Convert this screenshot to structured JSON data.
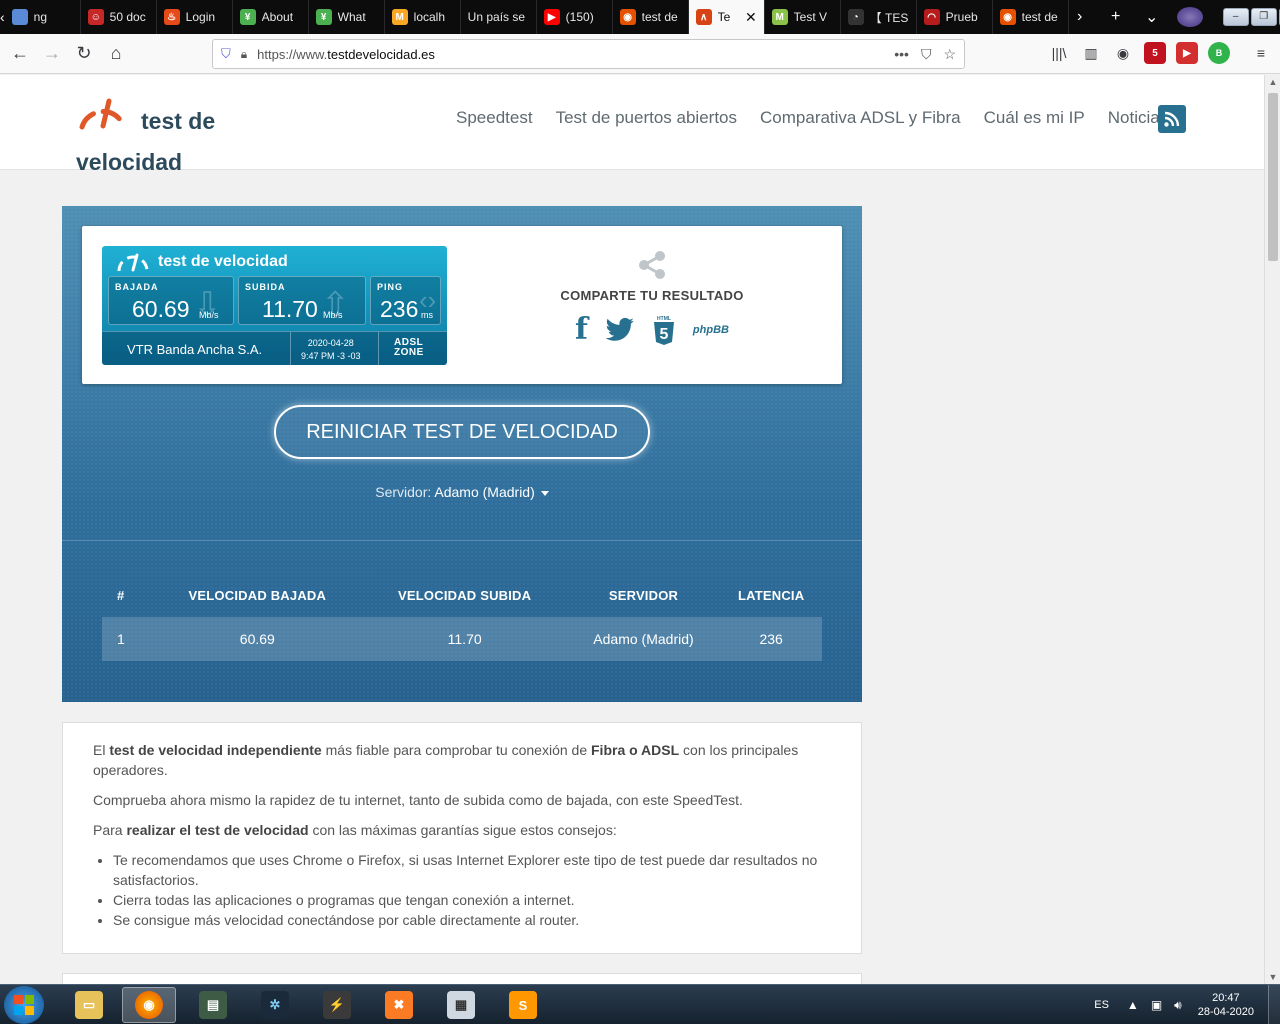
{
  "browser": {
    "tabs": [
      {
        "label": "ng",
        "fav_color": "#5b8bd6",
        "fav_glyph": ""
      },
      {
        "label": "50 doc",
        "fav_color": "#c62828",
        "fav_glyph": "☺"
      },
      {
        "label": "Login",
        "fav_color": "#e64a19",
        "fav_glyph": "♨"
      },
      {
        "label": "About",
        "fav_color": "#4caf50",
        "fav_glyph": "¥"
      },
      {
        "label": "What",
        "fav_color": "#4caf50",
        "fav_glyph": "¥"
      },
      {
        "label": "localh",
        "fav_color": "#f9a825",
        "fav_glyph": "M"
      },
      {
        "label": "Un país se",
        "fav_color": "",
        "fav_glyph": ""
      },
      {
        "label": "(150)",
        "fav_color": "#ff0000",
        "fav_glyph": "▶"
      },
      {
        "label": "test de",
        "fav_color": "#e65100",
        "fav_glyph": "◉"
      },
      {
        "label": "Te",
        "fav_color": "#d84315",
        "fav_glyph": "∧"
      },
      {
        "label": "Test V",
        "fav_color": "#8bc34a",
        "fav_glyph": "M"
      },
      {
        "label": "【 TES",
        "fav_color": "#333",
        "fav_glyph": "◔"
      },
      {
        "label": "Prueb",
        "fav_color": "#b71c1c",
        "fav_glyph": "◠"
      },
      {
        "label": "test de",
        "fav_color": "#e65100",
        "fav_glyph": "◉"
      }
    ],
    "active_tab_index": 9,
    "url_prefix": "https://www.",
    "url_domain": "testdevelocidad.es",
    "extension_badge": "5"
  },
  "site": {
    "logo_text": "test de velocidad",
    "menu": [
      "Speedtest",
      "Test de puertos abiertos",
      "Comparativa ADSL y Fibra",
      "Cuál es mi IP",
      "Noticias"
    ],
    "colors": {
      "brand": "#2d4a5c",
      "accent": "#e0572a",
      "hero": "#2f6e9c"
    }
  },
  "badge": {
    "title": "test de velocidad",
    "download_label": "BAJADA",
    "download_value": "60.69",
    "download_unit": "Mb/s",
    "upload_label": "SUBIDA",
    "upload_value": "11.70",
    "upload_unit": "Mb/s",
    "ping_label": "PING",
    "ping_value": "236",
    "ping_unit": "ms",
    "isp": "VTR Banda Ancha S.A.",
    "date": "2020-04-28",
    "time": "9:47 PM -3 -03",
    "brand_line1": "ADSL",
    "brand_line2": "ZONE"
  },
  "share": {
    "title": "COMPARTE TU RESULTADO",
    "html5_label": "HTML",
    "phpbb_label": "phpBB"
  },
  "test": {
    "restart_label": "REINICIAR TEST DE VELOCIDAD",
    "server_label": "Servidor:",
    "server_value": "Adamo (Madrid)"
  },
  "results": {
    "headers": [
      "#",
      "VELOCIDAD BAJADA",
      "VELOCIDAD SUBIDA",
      "SERVIDOR",
      "LATENCIA"
    ],
    "rows": [
      [
        "1",
        "60.69",
        "11.70",
        "Adamo (Madrid)",
        "236"
      ]
    ]
  },
  "intro": {
    "p1_a": "El ",
    "p1_b": "test de velocidad independiente",
    "p1_c": " más fiable para comprobar tu conexión de ",
    "p1_d": "Fibra o ADSL",
    "p1_e": " con los principales operadores.",
    "p2": "Comprueba ahora mismo la rapidez de tu internet, tanto de subida como de bajada, con este SpeedTest.",
    "p3_a": "Para ",
    "p3_b": "realizar el test de velocidad",
    "p3_c": " con las máximas garantías sigue estos consejos:",
    "tips": [
      "Te recomendamos que uses Chrome o Firefox, si usas Internet Explorer este tipo de test puede dar resultados no satisfactorios.",
      "Cierra todas las aplicaciones o programas que tengan conexión a internet.",
      "Se consigue más velocidad conectándose por cable directamente al router."
    ]
  },
  "taskbar": {
    "language": "ES",
    "time": "20:47",
    "date": "28-04-2020"
  }
}
